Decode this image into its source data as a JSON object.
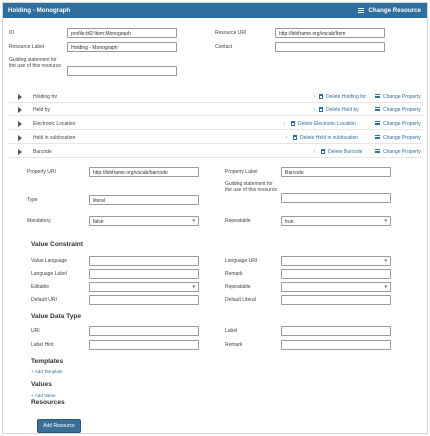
{
  "header": {
    "title": "Holding - Monograph",
    "change_resource": "Change Resource"
  },
  "top_form": {
    "id_label": "ID",
    "id_value": "profile:bf2:Item:Monograph",
    "resource_uri_label": "Resource URI",
    "resource_uri_value": "http://bibframe.org/vocab/Item",
    "resource_label_label": "Resource Label",
    "resource_label_value": "Holding - Monograph",
    "contact_label": "Contact",
    "contact_value": "",
    "guiding_label": "Guiding statement for the use of this resource",
    "guiding_value": ""
  },
  "properties": [
    {
      "name": "Holding for",
      "delete": "Delete Holding for",
      "change": "Change Property",
      "show_up": true
    },
    {
      "name": "Held by",
      "delete": "Delete Held by",
      "change": "Change Property",
      "show_up": true
    },
    {
      "name": "Electronic Location",
      "delete": "Delete Electronic Location",
      "change": "Change Property",
      "show_up": true
    },
    {
      "name": "Held in sublocation",
      "delete": "Delete Held in sublocation",
      "change": "Change Property",
      "show_up": true
    },
    {
      "name": "Barcode",
      "delete": "Delete Barcode",
      "change": "Change Property",
      "show_up": true
    }
  ],
  "up_arrow": "↑",
  "property_form": {
    "property_uri_label": "Property URI",
    "property_uri_value": "http://bibframe.org/vocab/barcode",
    "property_label_label": "Property Label",
    "property_label_value": "Barcode",
    "guiding_label": "Guiding statement for the use of this resource",
    "guiding_value": "",
    "type_label": "Type",
    "type_value": "literal",
    "mandatory_label": "Mandatory",
    "mandatory_value": "false",
    "repeatable_label": "Repeatable",
    "repeatable_value": "true"
  },
  "value_constraint": {
    "title": "Value Constraint",
    "value_language_label": "Value Language",
    "value_language_value": "",
    "language_uri_label": "Language URI",
    "language_uri_value": "",
    "language_label_label": "Language Label",
    "language_label_value": "",
    "remark_label": "Remark",
    "remark_value": "",
    "editable_label": "Editable",
    "editable_value": "",
    "repeatable_label": "Repeatable",
    "repeatable_value": "",
    "default_uri_label": "Default URI",
    "default_uri_value": "",
    "default_literal_label": "Default Literal",
    "default_literal_value": ""
  },
  "value_data_type": {
    "title": "Value Data Type",
    "uri_label": "URI",
    "uri_value": "",
    "label_label": "Label",
    "label_value": "",
    "label_hint_label": "Label Hint",
    "label_hint_value": "",
    "remark_label": "Remark",
    "remark_value": ""
  },
  "templates": {
    "title": "Templates",
    "add": "+ Add Template"
  },
  "values": {
    "title": "Values",
    "add": "+ Add Value"
  },
  "resources": {
    "title": "Resources",
    "add_button": "Add Resource"
  },
  "colors": {
    "header_bg": "#2f6f9f",
    "link": "#2f6f9f",
    "button_bg": "#3a6f97"
  }
}
